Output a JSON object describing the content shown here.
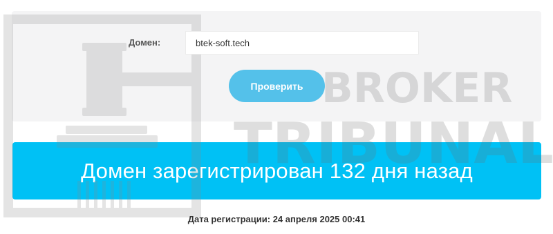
{
  "form": {
    "domain_label": "Домен:",
    "domain_value": "btek-soft.tech",
    "check_button": "Проверить"
  },
  "result": {
    "message": "Домен зарегистрирован 132 дня назад"
  },
  "registration": {
    "text": "Дата регистрации: 24 апреля 2025 00:41"
  },
  "watermark": {
    "line1": "BROKER",
    "line2": "TRIBUNAL",
    "icon": "gavel-icon"
  },
  "colors": {
    "card_bg": "#f4f4f5",
    "button_bg": "#54c1ea",
    "banner_bg": "#00c1f5",
    "watermark": "#b9b9b9"
  }
}
